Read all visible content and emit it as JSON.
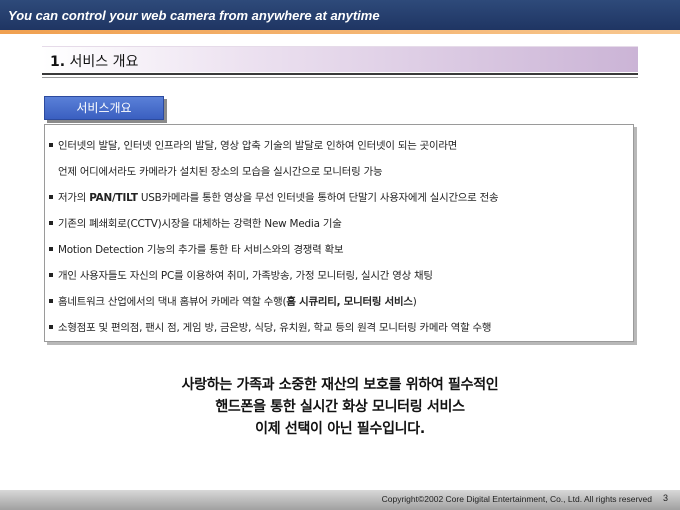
{
  "banner": {
    "tagline": "You can control your web camera  from anywhere at anytime"
  },
  "section": {
    "number": "1.",
    "title": "서비스 개요"
  },
  "tab": {
    "label": "서비스개요"
  },
  "bullets": [
    {
      "bullet": true,
      "text": "인터넷의 발달, 인터넷 인프라의 발달, 영상 압축 기술의 발달로 인하여 인터넷이 되는 곳이라면"
    },
    {
      "bullet": false,
      "text": "언제 어디에서라도 카메라가 설치된 장소의 모습을 실시간으로 모니터링 가능"
    },
    {
      "bullet": true,
      "pre": "저가의 ",
      "bold": "PAN/TILT",
      "post": " USB카메라를 통한 영상을 무선 인터넷을 통하여 단말기 사용자에게 실시간으로 전송"
    },
    {
      "bullet": true,
      "text": "기존의 폐쇄회로(CCTV)시장을 대체하는 강력한 New Media 기술"
    },
    {
      "bullet": true,
      "text": "Motion Detection 기능의 추가를 통한 타 서비스와의 경쟁력 확보"
    },
    {
      "bullet": true,
      "text": "개인 사용자들도 자신의 PC를 이용하여 취미, 가족방송, 가정 모니터링, 실시간 영상 채팅"
    },
    {
      "bullet": true,
      "pre": "홈네트워크 산업에서의 댁내 홈뷰어 카메라 역할 수행(",
      "bold": "홈 시큐리티, 모니터링 서비스",
      "post": ")"
    },
    {
      "bullet": true,
      "text": "소형점포 및 편의점, 팬시 점, 게임 방, 금은방, 식당, 유치원, 학교 등의 원격 모니터링 카메라 역할 수행"
    }
  ],
  "slogan": {
    "line1": "사랑하는 가족과 소중한 재산의 보호를 위하여 필수적인",
    "line2": "핸드폰을 통한 실시간 화상 모니터링 서비스",
    "line3": "이제 선택이 아닌 필수입니다."
  },
  "footer": {
    "copyright": "Copyright©2002 Core Digital Entertainment, Co., Ltd. All rights reserved",
    "page": "3"
  }
}
